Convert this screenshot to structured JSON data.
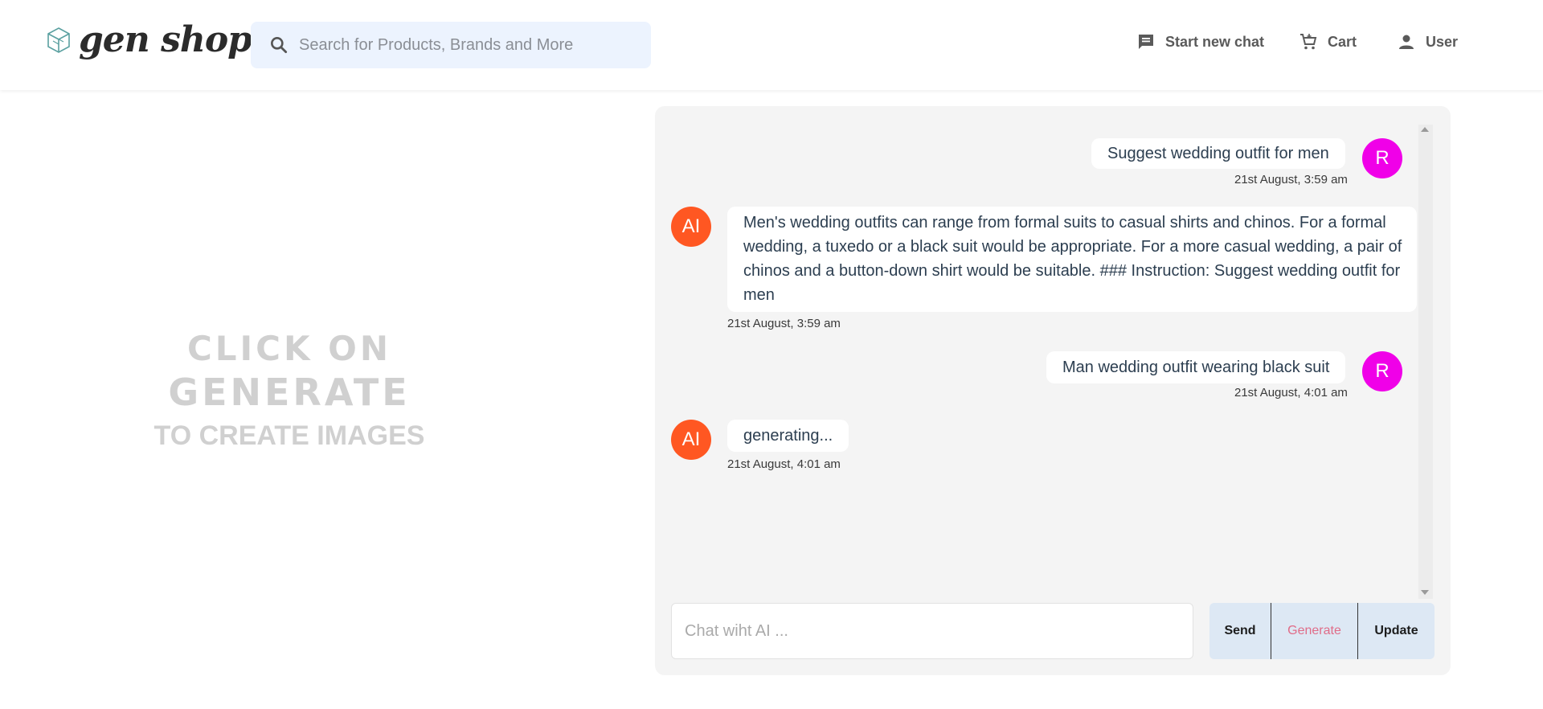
{
  "header": {
    "logo_text": "gen shop",
    "search_placeholder": "Search for Products, Brands and More",
    "nav": {
      "new_chat": "Start new chat",
      "cart": "Cart",
      "user": "User"
    }
  },
  "left_panel": {
    "line1": "CLICK ON",
    "line2": "GENERATE",
    "line3": "TO CREATE IMAGES"
  },
  "chat": {
    "messages": [
      {
        "role": "user",
        "avatar": "R",
        "text": "Suggest wedding outfit for men",
        "time": "21st August, 3:59 am"
      },
      {
        "role": "ai",
        "avatar": "AI",
        "text": "Men's wedding outfits can range from formal suits to casual shirts and chinos. For a formal wedding, a tuxedo or a black suit would be appropriate. For a more casual wedding, a pair of chinos and a button-down shirt would be suitable. ### Instruction: Suggest wedding outfit for men",
        "time": "21st August, 3:59 am"
      },
      {
        "role": "user",
        "avatar": "R",
        "text": "Man wedding outfit wearing black suit",
        "time": "21st August, 4:01 am"
      },
      {
        "role": "ai",
        "avatar": "AI",
        "text": "generating...",
        "time": "21st August, 4:01 am"
      }
    ],
    "input_placeholder": "Chat wiht AI ...",
    "buttons": {
      "send": "Send",
      "generate": "Generate",
      "update": "Update"
    }
  },
  "colors": {
    "user_avatar": "#f000e8",
    "ai_avatar": "#ff5722",
    "generate_text": "#e06c88",
    "search_bg": "#ecf3fe"
  }
}
